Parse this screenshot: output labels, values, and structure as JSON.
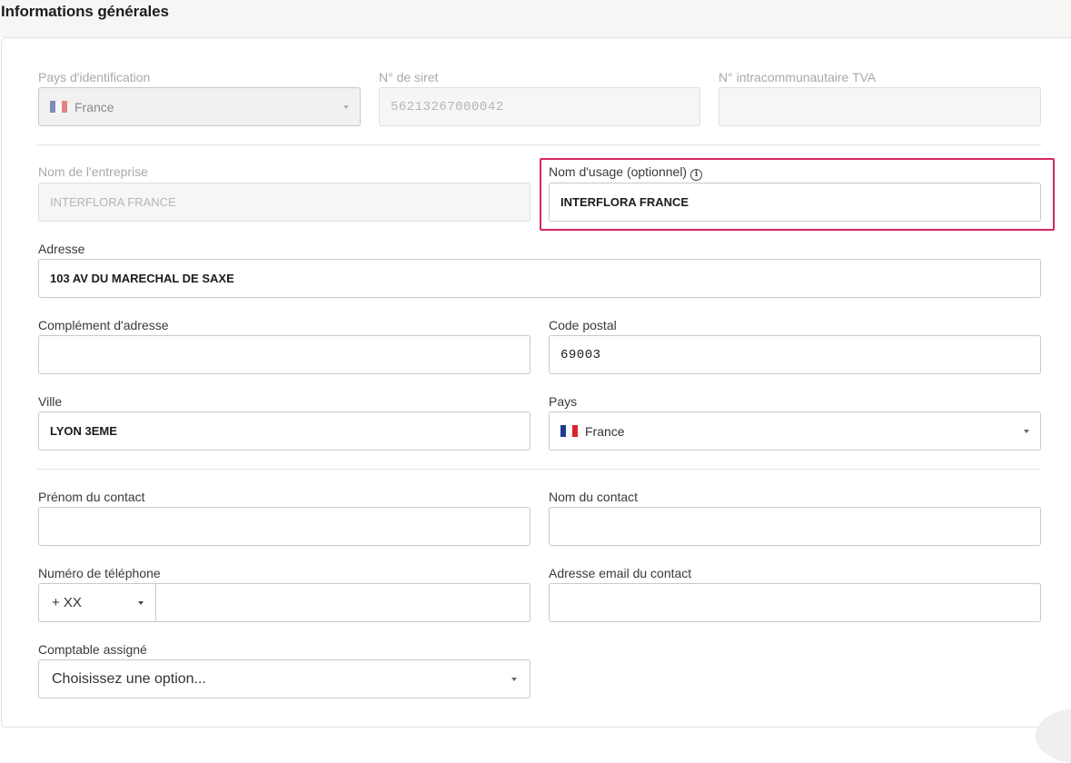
{
  "section": {
    "title": "Informations générales"
  },
  "fields": {
    "pays_identification": {
      "label": "Pays d'identification",
      "value": "France"
    },
    "siret": {
      "label": "N° de siret",
      "value": "56213267000042"
    },
    "tva": {
      "label": "N° intracommunautaire TVA",
      "value": ""
    },
    "nom_entreprise": {
      "label": "Nom de l'entreprise",
      "value": "INTERFLORA FRANCE"
    },
    "nom_usage": {
      "label": "Nom d'usage (optionnel)",
      "value": "INTERFLORA FRANCE",
      "info_icon": "info-icon"
    },
    "adresse": {
      "label": "Adresse",
      "value": "103 AV DU MARECHAL DE SAXE"
    },
    "complement": {
      "label": "Complément d'adresse",
      "value": ""
    },
    "code_postal": {
      "label": "Code postal",
      "value": "69003"
    },
    "ville": {
      "label": "Ville",
      "value": "LYON 3EME"
    },
    "pays": {
      "label": "Pays",
      "value": "France"
    },
    "prenom_contact": {
      "label": "Prénom du contact",
      "value": ""
    },
    "nom_contact": {
      "label": "Nom du contact",
      "value": ""
    },
    "telephone": {
      "label": "Numéro de téléphone",
      "prefix": "+ XX",
      "value": ""
    },
    "email_contact": {
      "label": "Adresse email du contact",
      "value": ""
    },
    "comptable": {
      "label": "Comptable assigné",
      "placeholder": "Choisissez une option..."
    }
  },
  "colors": {
    "highlight": "#d6275f",
    "flag_blue": "#1f3b8f",
    "flag_white": "#ffffff",
    "flag_red": "#d9262e"
  }
}
